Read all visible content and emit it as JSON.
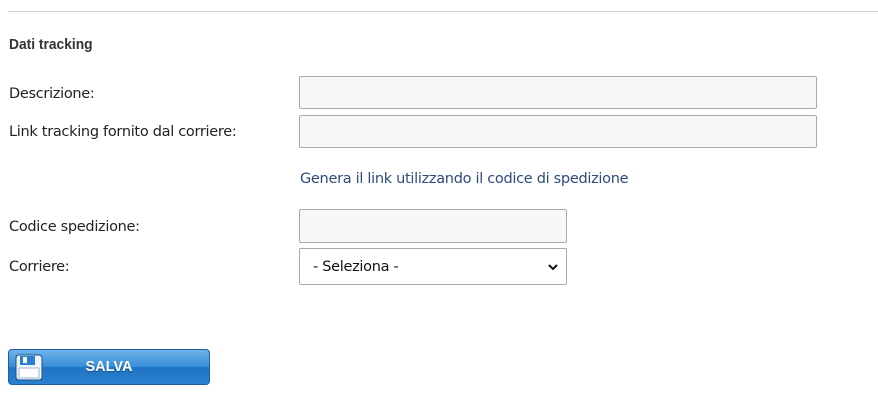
{
  "section": {
    "title": "Dati tracking"
  },
  "form": {
    "descrizione": {
      "label": "Descrizione:",
      "value": "",
      "placeholder": ""
    },
    "link_tracking": {
      "label": "Link tracking fornito dal corriere:",
      "value": "",
      "placeholder": ""
    },
    "generate_link": {
      "text": "Genera il link utilizzando il codice di spedizione"
    },
    "codice_spedizione": {
      "label": "Codice spedizione:",
      "value": "",
      "placeholder": ""
    },
    "corriere": {
      "label": "Corriere:",
      "selected": "- Seleziona -"
    }
  },
  "actions": {
    "save_label": "SALVA",
    "save_icon": "floppy-disk-icon"
  },
  "colors": {
    "link": "#2e4a7a",
    "button_blue": "#2a80cf",
    "input_bg": "#f7f7f7"
  }
}
